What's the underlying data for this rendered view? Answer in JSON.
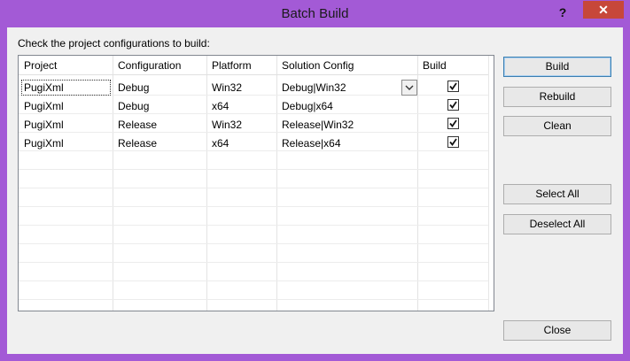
{
  "window": {
    "title": "Batch Build",
    "help_label": "?",
    "close_label": "✕"
  },
  "instructions": "Check the project configurations to build:",
  "table": {
    "headers": [
      "Project",
      "Configuration",
      "Platform",
      "Solution Config",
      "Build"
    ],
    "rows": [
      {
        "project": "PugiXml",
        "configuration": "Debug",
        "platform": "Win32",
        "solution_config": "Debug|Win32",
        "build": true
      },
      {
        "project": "PugiXml",
        "configuration": "Debug",
        "platform": "x64",
        "solution_config": "Debug|x64",
        "build": true
      },
      {
        "project": "PugiXml",
        "configuration": "Release",
        "platform": "Win32",
        "solution_config": "Release|Win32",
        "build": true
      },
      {
        "project": "PugiXml",
        "configuration": "Release",
        "platform": "x64",
        "solution_config": "Release|x64",
        "build": true
      }
    ]
  },
  "buttons": {
    "build": "Build",
    "rebuild": "Rebuild",
    "clean": "Clean",
    "select_all": "Select All",
    "deselect_all": "Deselect All",
    "close": "Close"
  },
  "colors": {
    "frame": "#a35ad6",
    "close_button": "#c7473a",
    "dialog_bg": "#f0f0f0"
  }
}
